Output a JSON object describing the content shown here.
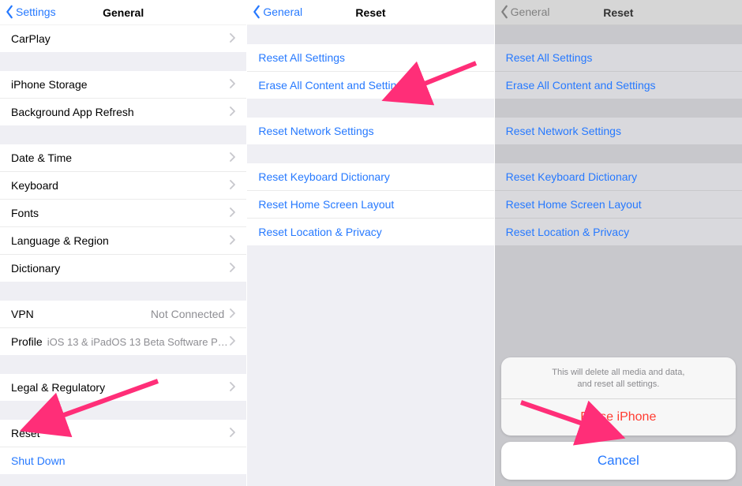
{
  "screen1": {
    "back": "Settings",
    "title": "General",
    "rows": [
      {
        "label": "CarPlay",
        "chevron": true
      },
      {
        "label": "iPhone Storage",
        "chevron": true
      },
      {
        "label": "Background App Refresh",
        "chevron": true
      },
      {
        "label": "Date & Time",
        "chevron": true
      },
      {
        "label": "Keyboard",
        "chevron": true
      },
      {
        "label": "Fonts",
        "chevron": true
      },
      {
        "label": "Language & Region",
        "chevron": true
      },
      {
        "label": "Dictionary",
        "chevron": true
      },
      {
        "label": "VPN",
        "value": "Not Connected",
        "chevron": true
      },
      {
        "label": "Profile",
        "sub": "iOS 13 & iPadOS 13 Beta Software Pr…",
        "chevron": true
      },
      {
        "label": "Legal & Regulatory",
        "chevron": true
      },
      {
        "label": "Reset",
        "chevron": true
      },
      {
        "label": "Shut Down",
        "linkBlue": true
      }
    ]
  },
  "screen2": {
    "back": "General",
    "title": "Reset",
    "groups": [
      [
        "Reset All Settings",
        "Erase All Content and Settings"
      ],
      [
        "Reset Network Settings"
      ],
      [
        "Reset Keyboard Dictionary",
        "Reset Home Screen Layout",
        "Reset Location & Privacy"
      ]
    ]
  },
  "screen3": {
    "back": "General",
    "title": "Reset",
    "groups": [
      [
        "Reset All Settings",
        "Erase All Content and Settings"
      ],
      [
        "Reset Network Settings"
      ],
      [
        "Reset Keyboard Dictionary",
        "Reset Home Screen Layout",
        "Reset Location & Privacy"
      ]
    ],
    "sheet": {
      "message1": "This will delete all media and data,",
      "message2": "and reset all settings.",
      "destructive": "Erase iPhone",
      "cancel": "Cancel"
    }
  }
}
